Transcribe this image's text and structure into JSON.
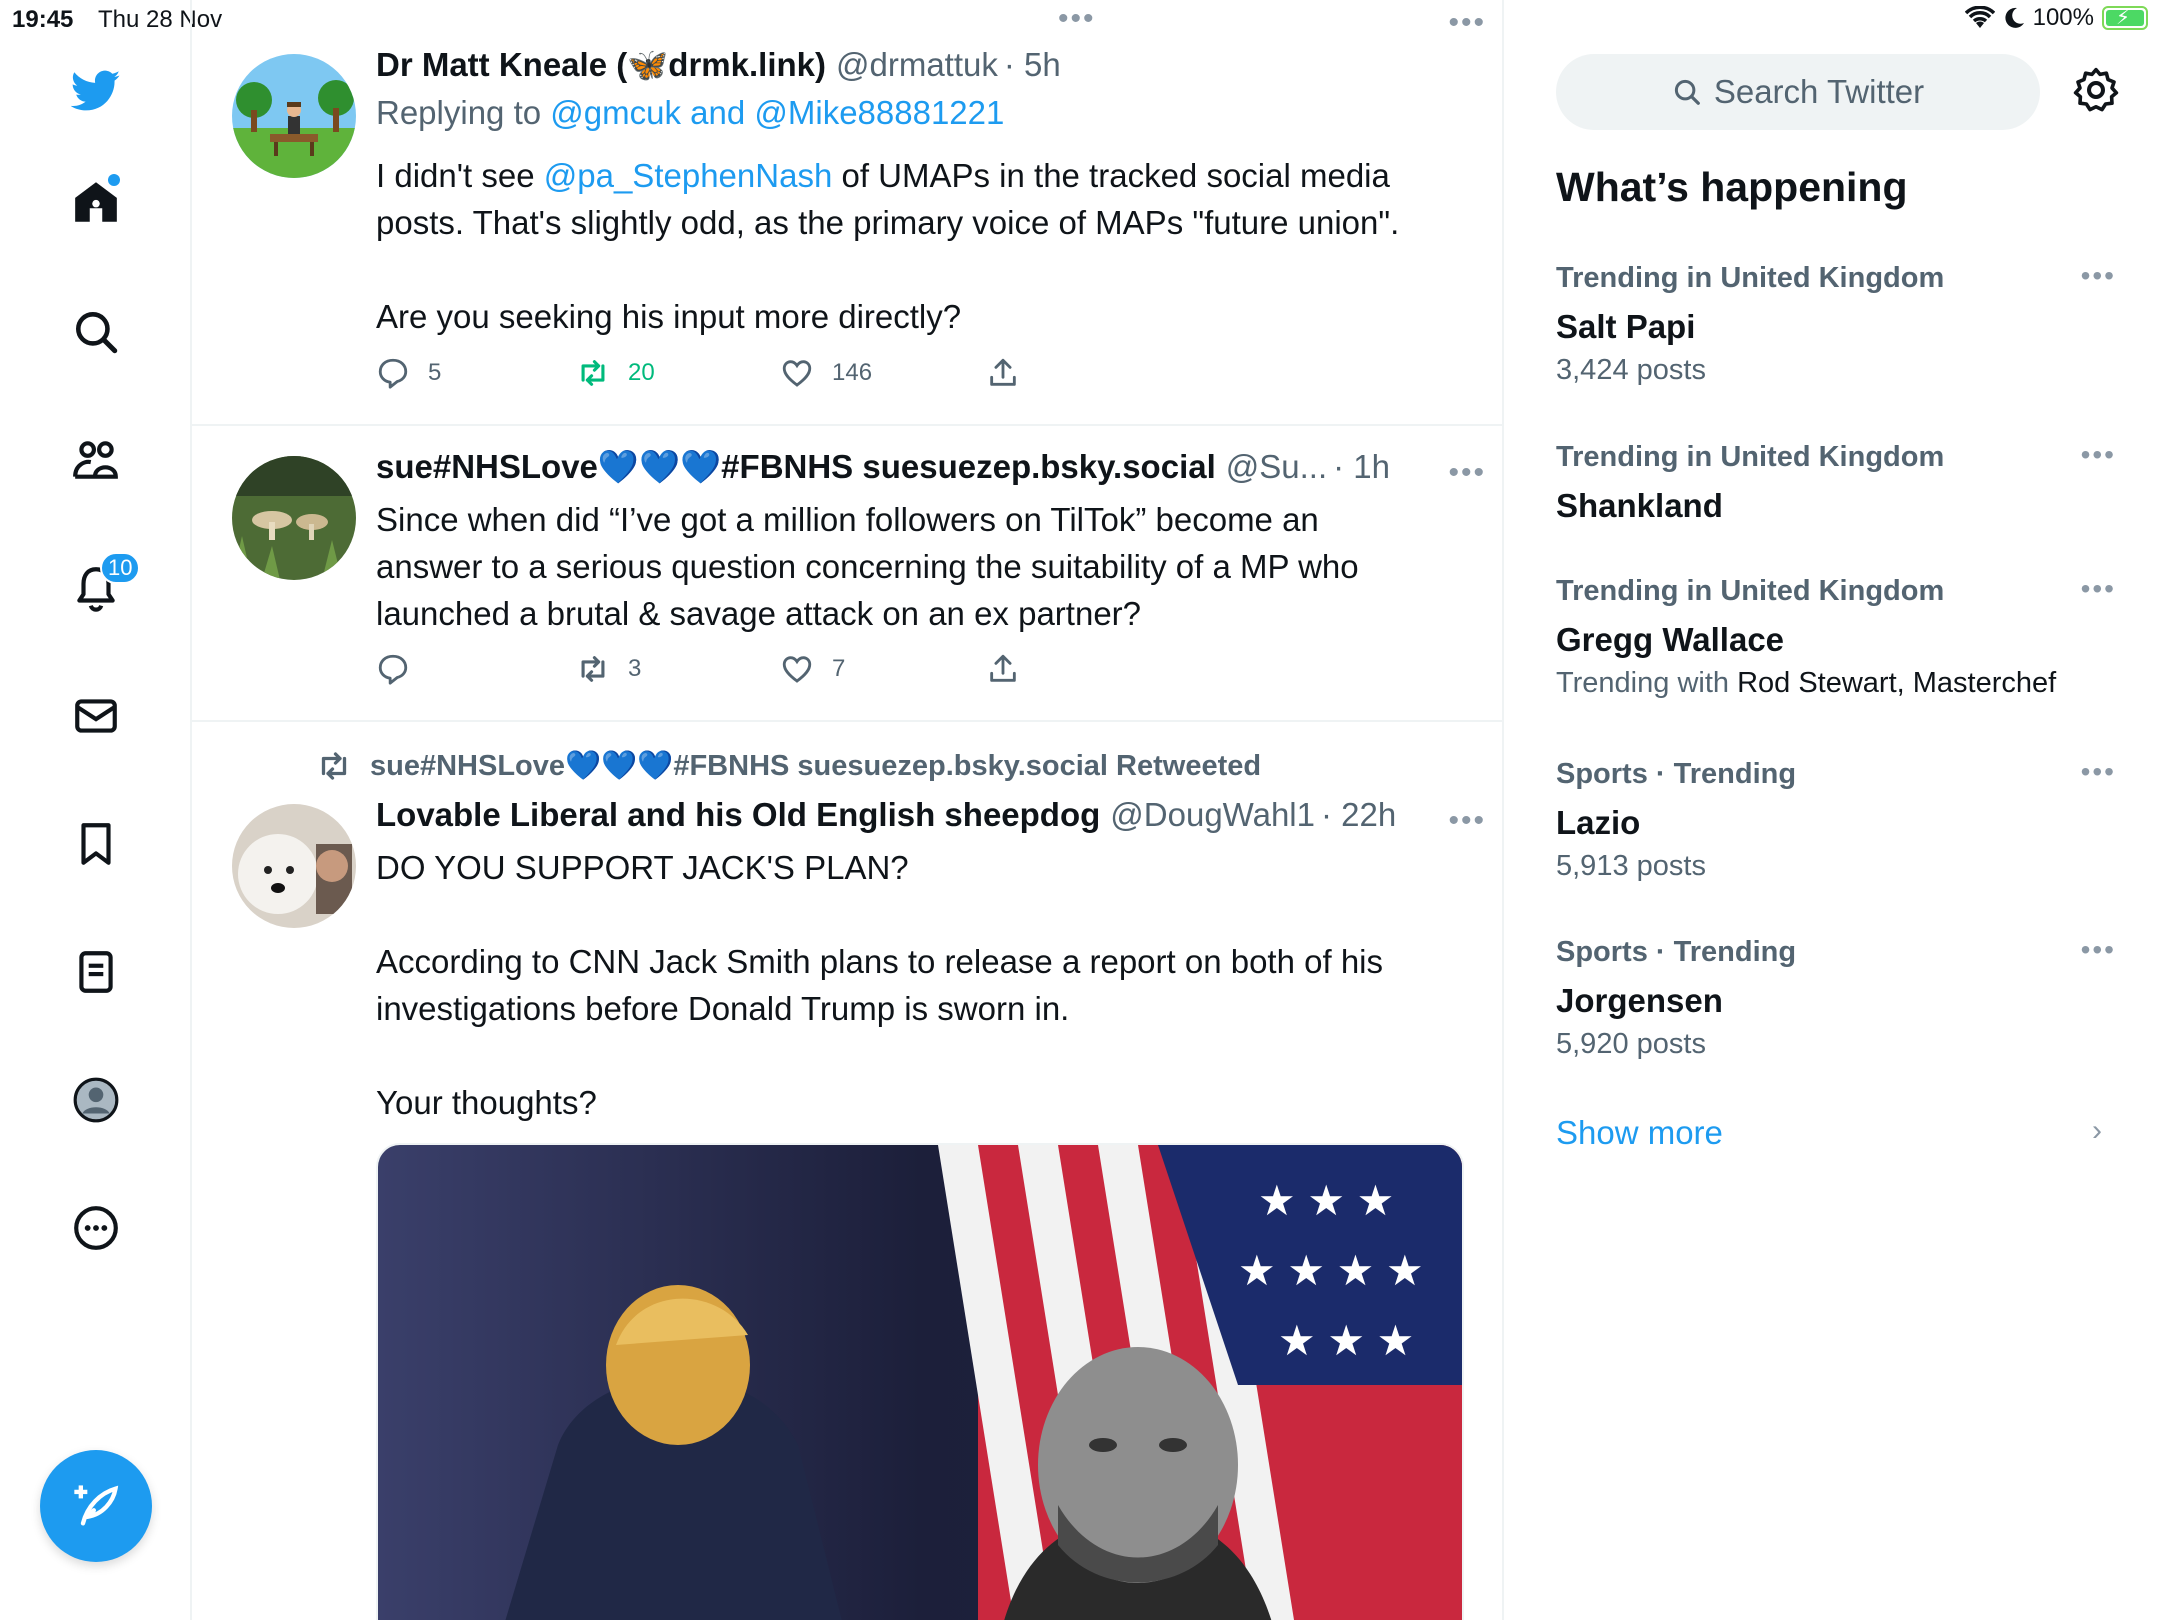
{
  "status_bar": {
    "time": "19:45",
    "date": "Thu 28 Nov",
    "battery": "100%"
  },
  "nav": {
    "notifications_badge": "10"
  },
  "colors": {
    "accent": "#1d9bf0",
    "retweet_green": "#00ba7c",
    "muted": "#536471"
  },
  "tweets": [
    {
      "name": "Dr Matt Kneale (🦋drmk.link)",
      "handle": "@drmattuk",
      "time": "· 5h",
      "replying_prefix": "Replying to",
      "replying_users": "@gmcuk and @Mike88881221",
      "text_pre": "I didn't see ",
      "text_mention": "@pa_StephenNash",
      "text_post": " of UMAPs in the tracked social media\nposts. That's slightly odd, as the primary voice of MAPs \"future union\".\n\nAre you seeking his input more directly?",
      "replies": "5",
      "retweets": "20",
      "likes": "146"
    },
    {
      "name": "sue#NHSLove💙💙💙#FBNHS suesuezep.bsky.social",
      "handle": "@Su...",
      "time": "· 1h",
      "text": "Since when did “I’ve got a million followers on TilTok” become an\nanswer to a serious question concerning the suitability of a MP who\nlaunched a brutal & savage attack on an ex partner?",
      "replies": "",
      "retweets": "3",
      "likes": "7"
    },
    {
      "retweeted_by": "sue#NHSLove💙💙💙#FBNHS suesuezep.bsky.social Retweeted",
      "name": "Lovable Liberal and his Old English sheepdog",
      "handle": "@DougWahl1",
      "time": "· 22h",
      "text": "DO YOU SUPPORT JACK'S PLAN?\n\nAccording to CNN Jack Smith plans to release a report on both of his\ninvestigations before Donald Trump is sworn in.\n\nYour thoughts?"
    }
  ],
  "sidebar": {
    "search_placeholder": "Search Twitter",
    "section_title": "What’s happening",
    "trends": [
      {
        "context": "Trending in United Kingdom",
        "name": "Salt Papi",
        "sub": "3,424 posts"
      },
      {
        "context": "Trending in United Kingdom",
        "name": "Shankland",
        "sub": ""
      },
      {
        "context": "Trending in United Kingdom",
        "name": "Gregg Wallace",
        "sub_prefix": "Trending with ",
        "sub_dark": "Rod Stewart, Masterchef"
      },
      {
        "context": "Sports · Trending",
        "name": "Lazio",
        "sub": "5,913 posts"
      },
      {
        "context": "Sports · Trending",
        "name": "Jorgensen",
        "sub": "5,920 posts"
      }
    ],
    "show_more": "Show more"
  }
}
